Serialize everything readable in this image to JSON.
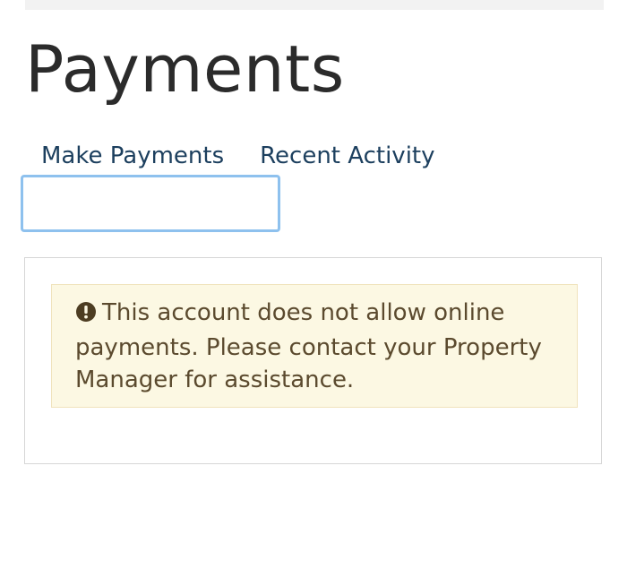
{
  "page": {
    "title": "Payments"
  },
  "tabs": [
    {
      "label": "Make Payments"
    },
    {
      "label": "Recent Activity"
    }
  ],
  "alert": {
    "icon": "exclamation-circle-icon",
    "message": "This account does not allow online payments. Please contact your Property Manager for assistance.",
    "background_color": "#fcf8e3",
    "text_color": "#5b4a2e"
  },
  "colors": {
    "tab_text": "#1c3f5e",
    "focus_outline": "#8ec1ee",
    "title_text": "#2b2b2b"
  }
}
